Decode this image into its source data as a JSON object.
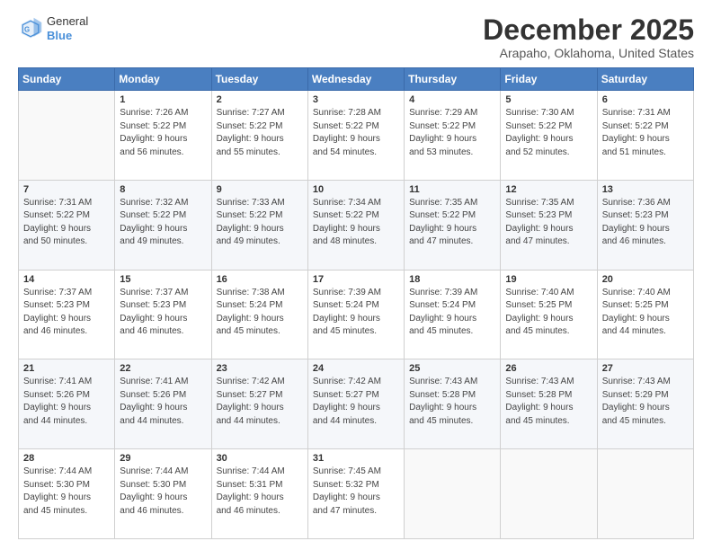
{
  "logo": {
    "general": "General",
    "blue": "Blue"
  },
  "header": {
    "month": "December 2025",
    "location": "Arapaho, Oklahoma, United States"
  },
  "weekdays": [
    "Sunday",
    "Monday",
    "Tuesday",
    "Wednesday",
    "Thursday",
    "Friday",
    "Saturday"
  ],
  "weeks": [
    [
      {
        "day": "",
        "info": ""
      },
      {
        "day": "1",
        "info": "Sunrise: 7:26 AM\nSunset: 5:22 PM\nDaylight: 9 hours\nand 56 minutes."
      },
      {
        "day": "2",
        "info": "Sunrise: 7:27 AM\nSunset: 5:22 PM\nDaylight: 9 hours\nand 55 minutes."
      },
      {
        "day": "3",
        "info": "Sunrise: 7:28 AM\nSunset: 5:22 PM\nDaylight: 9 hours\nand 54 minutes."
      },
      {
        "day": "4",
        "info": "Sunrise: 7:29 AM\nSunset: 5:22 PM\nDaylight: 9 hours\nand 53 minutes."
      },
      {
        "day": "5",
        "info": "Sunrise: 7:30 AM\nSunset: 5:22 PM\nDaylight: 9 hours\nand 52 minutes."
      },
      {
        "day": "6",
        "info": "Sunrise: 7:31 AM\nSunset: 5:22 PM\nDaylight: 9 hours\nand 51 minutes."
      }
    ],
    [
      {
        "day": "7",
        "info": "Sunrise: 7:31 AM\nSunset: 5:22 PM\nDaylight: 9 hours\nand 50 minutes."
      },
      {
        "day": "8",
        "info": "Sunrise: 7:32 AM\nSunset: 5:22 PM\nDaylight: 9 hours\nand 49 minutes."
      },
      {
        "day": "9",
        "info": "Sunrise: 7:33 AM\nSunset: 5:22 PM\nDaylight: 9 hours\nand 49 minutes."
      },
      {
        "day": "10",
        "info": "Sunrise: 7:34 AM\nSunset: 5:22 PM\nDaylight: 9 hours\nand 48 minutes."
      },
      {
        "day": "11",
        "info": "Sunrise: 7:35 AM\nSunset: 5:22 PM\nDaylight: 9 hours\nand 47 minutes."
      },
      {
        "day": "12",
        "info": "Sunrise: 7:35 AM\nSunset: 5:23 PM\nDaylight: 9 hours\nand 47 minutes."
      },
      {
        "day": "13",
        "info": "Sunrise: 7:36 AM\nSunset: 5:23 PM\nDaylight: 9 hours\nand 46 minutes."
      }
    ],
    [
      {
        "day": "14",
        "info": "Sunrise: 7:37 AM\nSunset: 5:23 PM\nDaylight: 9 hours\nand 46 minutes."
      },
      {
        "day": "15",
        "info": "Sunrise: 7:37 AM\nSunset: 5:23 PM\nDaylight: 9 hours\nand 46 minutes."
      },
      {
        "day": "16",
        "info": "Sunrise: 7:38 AM\nSunset: 5:24 PM\nDaylight: 9 hours\nand 45 minutes."
      },
      {
        "day": "17",
        "info": "Sunrise: 7:39 AM\nSunset: 5:24 PM\nDaylight: 9 hours\nand 45 minutes."
      },
      {
        "day": "18",
        "info": "Sunrise: 7:39 AM\nSunset: 5:24 PM\nDaylight: 9 hours\nand 45 minutes."
      },
      {
        "day": "19",
        "info": "Sunrise: 7:40 AM\nSunset: 5:25 PM\nDaylight: 9 hours\nand 45 minutes."
      },
      {
        "day": "20",
        "info": "Sunrise: 7:40 AM\nSunset: 5:25 PM\nDaylight: 9 hours\nand 44 minutes."
      }
    ],
    [
      {
        "day": "21",
        "info": "Sunrise: 7:41 AM\nSunset: 5:26 PM\nDaylight: 9 hours\nand 44 minutes."
      },
      {
        "day": "22",
        "info": "Sunrise: 7:41 AM\nSunset: 5:26 PM\nDaylight: 9 hours\nand 44 minutes."
      },
      {
        "day": "23",
        "info": "Sunrise: 7:42 AM\nSunset: 5:27 PM\nDaylight: 9 hours\nand 44 minutes."
      },
      {
        "day": "24",
        "info": "Sunrise: 7:42 AM\nSunset: 5:27 PM\nDaylight: 9 hours\nand 44 minutes."
      },
      {
        "day": "25",
        "info": "Sunrise: 7:43 AM\nSunset: 5:28 PM\nDaylight: 9 hours\nand 45 minutes."
      },
      {
        "day": "26",
        "info": "Sunrise: 7:43 AM\nSunset: 5:28 PM\nDaylight: 9 hours\nand 45 minutes."
      },
      {
        "day": "27",
        "info": "Sunrise: 7:43 AM\nSunset: 5:29 PM\nDaylight: 9 hours\nand 45 minutes."
      }
    ],
    [
      {
        "day": "28",
        "info": "Sunrise: 7:44 AM\nSunset: 5:30 PM\nDaylight: 9 hours\nand 45 minutes."
      },
      {
        "day": "29",
        "info": "Sunrise: 7:44 AM\nSunset: 5:30 PM\nDaylight: 9 hours\nand 46 minutes."
      },
      {
        "day": "30",
        "info": "Sunrise: 7:44 AM\nSunset: 5:31 PM\nDaylight: 9 hours\nand 46 minutes."
      },
      {
        "day": "31",
        "info": "Sunrise: 7:45 AM\nSunset: 5:32 PM\nDaylight: 9 hours\nand 47 minutes."
      },
      {
        "day": "",
        "info": ""
      },
      {
        "day": "",
        "info": ""
      },
      {
        "day": "",
        "info": ""
      }
    ]
  ]
}
